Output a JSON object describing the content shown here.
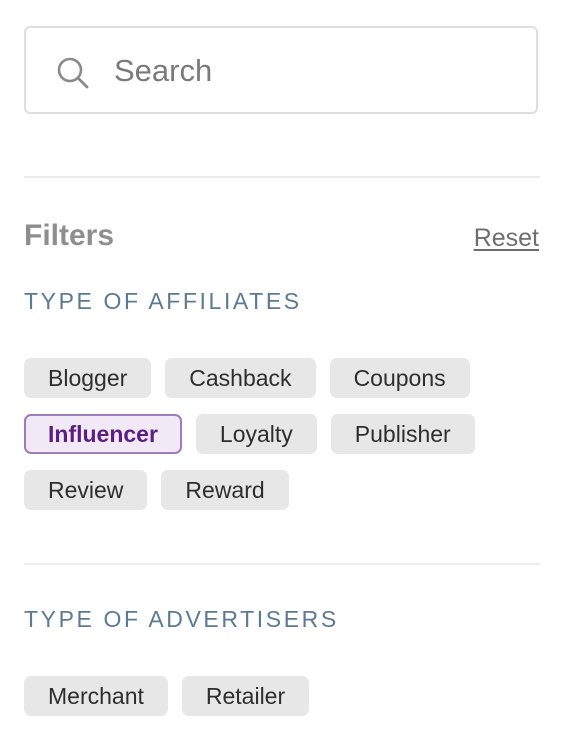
{
  "search": {
    "placeholder": "Search",
    "value": ""
  },
  "filters": {
    "heading": "Filters",
    "reset_label": "Reset"
  },
  "affiliates": {
    "title": "TYPE OF AFFILIATES",
    "chips": [
      {
        "label": "Blogger",
        "selected": false
      },
      {
        "label": "Cashback",
        "selected": false
      },
      {
        "label": "Coupons",
        "selected": false
      },
      {
        "label": "Influencer",
        "selected": true
      },
      {
        "label": "Loyalty",
        "selected": false
      },
      {
        "label": "Publisher",
        "selected": false
      },
      {
        "label": "Review",
        "selected": false
      },
      {
        "label": "Reward",
        "selected": false
      }
    ]
  },
  "advertisers": {
    "title": "TYPE OF ADVERTISERS",
    "chips": [
      {
        "label": "Merchant",
        "selected": false
      },
      {
        "label": "Retailer",
        "selected": false
      }
    ]
  },
  "colors": {
    "accent": "#5a1f80",
    "accent_border": "#a07bbd",
    "section_title": "#5b7a93",
    "chip_bg": "#e7e7e7"
  },
  "icons": {
    "search": "search-icon"
  }
}
